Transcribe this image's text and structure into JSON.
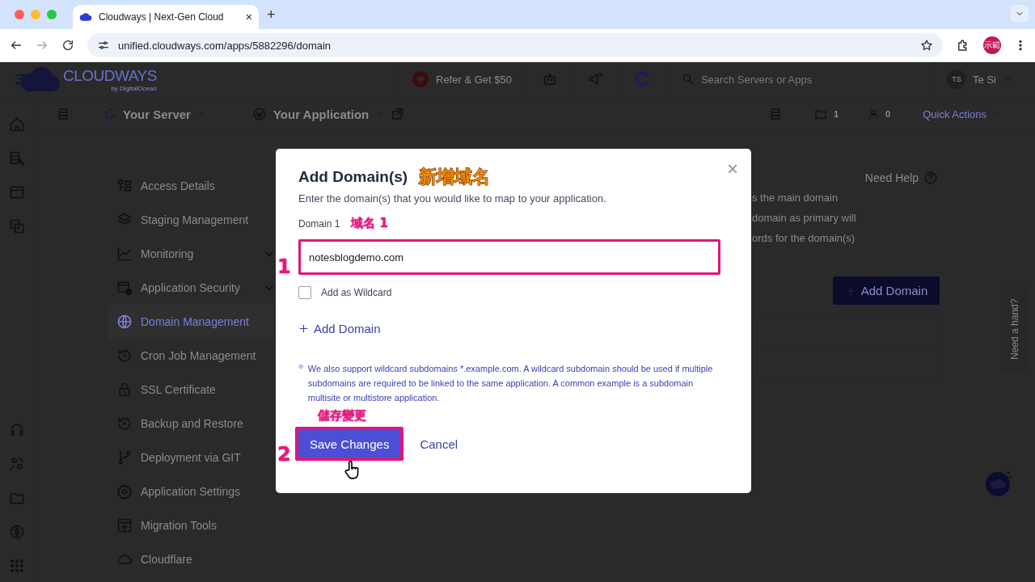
{
  "browser": {
    "tab_title": "Cloudways | Next-Gen Cloud",
    "tab_close": "×",
    "new_tab": "+",
    "url": "unified.cloudways.com/apps/5882296/domain",
    "profile": "示範"
  },
  "header": {
    "logo": "CLOUDWAYS",
    "logo_sub": "by DigitalOcean",
    "refer": "Refer & Get $50",
    "search": {
      "placeholder": "Search Servers or Apps"
    },
    "user": {
      "initials": "TS",
      "name": "Te Si"
    }
  },
  "breadcrumb": {
    "server": "Your Server",
    "application": "Your Application",
    "folders": "1",
    "members": "0",
    "quick_actions": "Quick Actions"
  },
  "menu": [
    {
      "label": "Access Details",
      "selected": false,
      "expandable": false
    },
    {
      "label": "Staging Management",
      "selected": false,
      "expandable": false
    },
    {
      "label": "Monitoring",
      "selected": false,
      "expandable": true
    },
    {
      "label": "Application Security",
      "selected": false,
      "expandable": true
    },
    {
      "label": "Domain Management",
      "selected": true,
      "expandable": false
    },
    {
      "label": "Cron Job Management",
      "selected": false,
      "expandable": false
    },
    {
      "label": "SSL Certificate",
      "selected": false,
      "expandable": false
    },
    {
      "label": "Backup and Restore",
      "selected": false,
      "expandable": false
    },
    {
      "label": "Deployment via GIT",
      "selected": false,
      "expandable": false
    },
    {
      "label": "Application Settings",
      "selected": false,
      "expandable": false
    },
    {
      "label": "Migration Tools",
      "selected": false,
      "expandable": false
    },
    {
      "label": "Cloudflare",
      "selected": false,
      "expandable": false
    }
  ],
  "content": {
    "need_help": "Need Help",
    "description_lines": [
      "s the main domain",
      "domain as primary will",
      "ords for the domain(s)"
    ],
    "add_domain": "Add Domain"
  },
  "need_a_hand": "Need a hand?",
  "modal": {
    "close": "×",
    "title": "Add Domain(s)",
    "subtitle": "Enter the domain(s) that you would like to map to your application.",
    "field_label": "Domain 1",
    "field_value": "notesblogdemo.com",
    "wildcard": {
      "label": "Add as Wildcard",
      "checked": false
    },
    "add_domain": "Add Domain",
    "note": "We also support wildcard subdomains *.example.com. A wildcard subdomain should be used if multiple subdomains are required to be linked to the same application. A common example is a subdomain multisite or multistore application.",
    "save": "Save Changes",
    "cancel": "Cancel"
  },
  "annotations": {
    "title_note": "新增域名",
    "field_note": "域名 1",
    "step_1": "1",
    "step_2": "2",
    "save_note": "儲存變更"
  }
}
